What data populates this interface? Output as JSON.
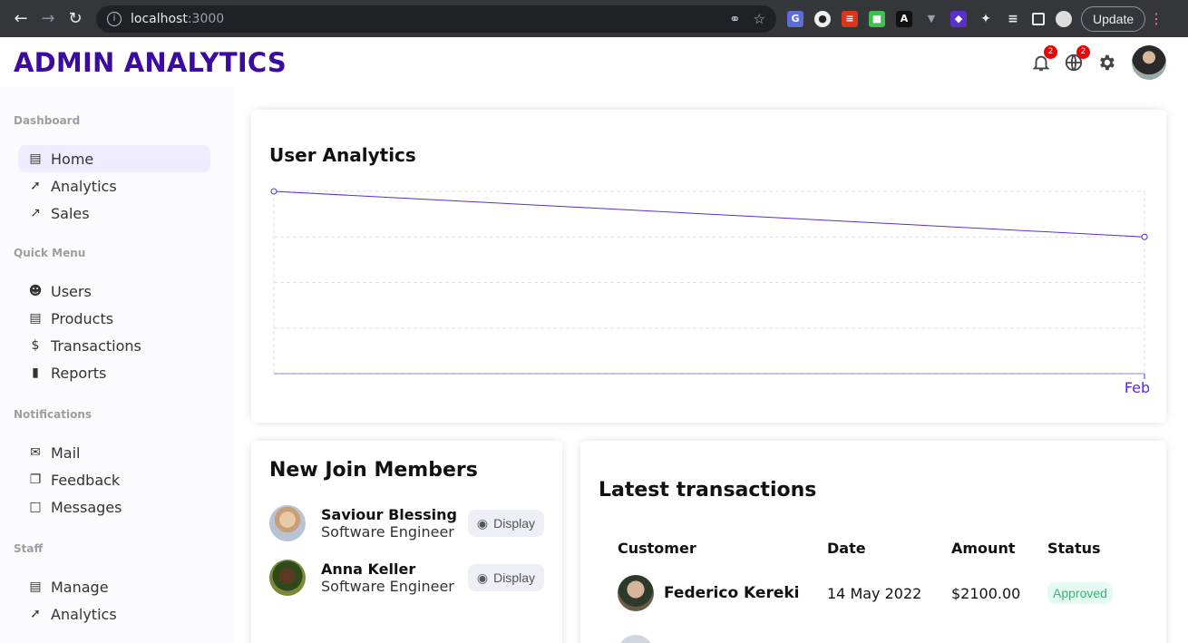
{
  "browser": {
    "url_host": "localhost",
    "url_port": ":3000",
    "update_label": "Update"
  },
  "app": {
    "logo": "ADMIN ANALYTICS",
    "notifications_count": "2",
    "language_count": "2"
  },
  "sidebar": {
    "sections": [
      {
        "title": "Dashboard",
        "items": [
          {
            "label": "Home",
            "icon": "line-style-icon",
            "active": true
          },
          {
            "label": "Analytics",
            "icon": "timeline-icon"
          },
          {
            "label": "Sales",
            "icon": "trending-up-icon"
          }
        ]
      },
      {
        "title": "Quick Menu",
        "items": [
          {
            "label": "Users",
            "icon": "person-icon"
          },
          {
            "label": "Products",
            "icon": "storefront-icon"
          },
          {
            "label": "Transactions",
            "icon": "dollar-icon"
          },
          {
            "label": "Reports",
            "icon": "bar-chart-icon"
          }
        ]
      },
      {
        "title": "Notifications",
        "items": [
          {
            "label": "Mail",
            "icon": "mail-icon"
          },
          {
            "label": "Feedback",
            "icon": "dynamic-feed-icon"
          },
          {
            "label": "Messages",
            "icon": "chat-bubble-icon"
          }
        ]
      },
      {
        "title": "Staff",
        "items": [
          {
            "label": "Manage",
            "icon": "work-icon"
          },
          {
            "label": "Analytics",
            "icon": "timeline-icon"
          }
        ]
      }
    ]
  },
  "analytics_card": {
    "title": "User Analytics"
  },
  "chart_data": {
    "type": "line",
    "title": "User Analytics",
    "x": [
      "",
      "Feb"
    ],
    "series": [
      {
        "values": [
          4,
          3
        ]
      }
    ],
    "ylim": [
      0,
      4
    ],
    "grid": true,
    "color": "#5a2bd6"
  },
  "members_card": {
    "title": "New Join Members",
    "members": [
      {
        "name": "Saviour Blessing",
        "job": "Software Engineer",
        "button": "Display"
      },
      {
        "name": "Anna Keller",
        "job": "Software Engineer",
        "button": "Display"
      }
    ]
  },
  "transactions_card": {
    "title": "Latest transactions",
    "headers": {
      "customer": "Customer",
      "date": "Date",
      "amount": "Amount",
      "status": "Status"
    },
    "rows": [
      {
        "customer": "Federico Kereki",
        "date": "14 May 2022",
        "amount": "$2100.00",
        "status": "Approved"
      }
    ]
  }
}
